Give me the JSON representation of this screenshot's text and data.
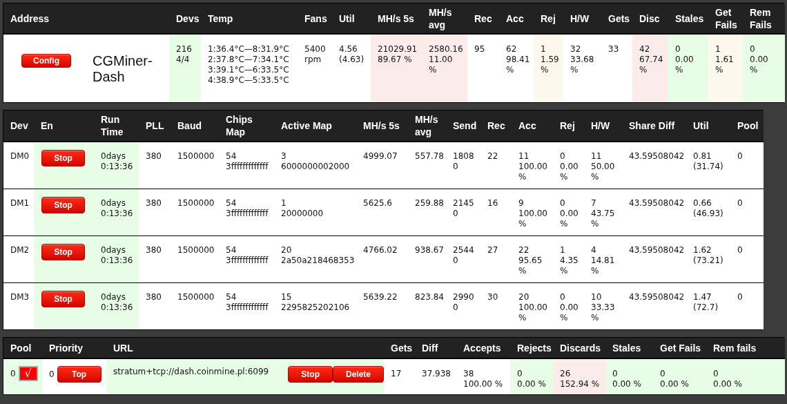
{
  "summary": {
    "columns": [
      "Address",
      "Devs",
      "Temp",
      "Fans",
      "Util",
      "MH/s 5s",
      "MH/s avg",
      "Rec",
      "Acc",
      "Rej",
      "H/W",
      "Gets",
      "Disc",
      "Stales",
      "Get Fails",
      "Rem Fails"
    ],
    "rows": [
      {
        "cells": [
          {
            "kind": "address",
            "color": "#ffffff",
            "parts": [
              {
                "kind": "button",
                "label": "Config"
              },
              {
                "kind": "name",
                "text": "CGMiner-Dash"
              }
            ]
          },
          {
            "kind": "text",
            "color": "#e8fde6",
            "lines": [
              "216",
              "4/4"
            ]
          },
          {
            "kind": "text",
            "color": "#ffffff",
            "lines": [
              "1:36.4°C—8:31.9°C",
              "2:37.8°C—7:34.1°C",
              "3:39.1°C—6:33.5°C",
              "4:38.9°C—5:33.5°C"
            ]
          },
          {
            "kind": "text",
            "color": "#ffffff",
            "lines": [
              "5400",
              "rpm"
            ]
          },
          {
            "kind": "text",
            "color": "#ffffff",
            "lines": [
              "4.56",
              "(4.63)"
            ]
          },
          {
            "kind": "text",
            "color": "#fbeceb",
            "lines": [
              "21029.91",
              "89.67 %"
            ]
          },
          {
            "kind": "text",
            "color": "#fbeceb",
            "lines": [
              "2580.16",
              "11.00",
              "%"
            ]
          },
          {
            "kind": "text",
            "color": "#ffffff",
            "lines": [
              "95"
            ]
          },
          {
            "kind": "text",
            "color": "#ffffff",
            "lines": [
              "62",
              "98.41",
              "%"
            ]
          },
          {
            "kind": "text",
            "color": "#fdf8ec",
            "lines": [
              "1",
              "1.59",
              "%"
            ]
          },
          {
            "kind": "text",
            "color": "#ffffff",
            "lines": [
              "32",
              "33.68",
              "%"
            ]
          },
          {
            "kind": "text",
            "color": "#ffffff",
            "lines": [
              "33"
            ]
          },
          {
            "kind": "text",
            "color": "#fbeceb",
            "lines": [
              "42",
              "67.74",
              "%"
            ]
          },
          {
            "kind": "text",
            "color": "#e8fde6",
            "lines": [
              "0",
              "0.00",
              "%"
            ]
          },
          {
            "kind": "text",
            "color": "#fdf8ec",
            "lines": [
              "1",
              "1.61",
              "%"
            ]
          },
          {
            "kind": "text",
            "color": "#e8fde6",
            "lines": [
              "0",
              "0.00",
              "%"
            ]
          }
        ]
      }
    ]
  },
  "devices": {
    "columns": [
      "Dev",
      "En",
      "Run Time",
      "PLL",
      "Baud",
      "Chips Map",
      "Active Map",
      "MH/s 5s",
      "MH/s avg",
      "Send",
      "Rec",
      "Acc",
      "Rej",
      "H/W",
      "Share Diff",
      "Util",
      "Pool"
    ],
    "rows": [
      {
        "cells": [
          {
            "kind": "text",
            "color": "#ffffff",
            "lines": [
              "DM0"
            ]
          },
          {
            "kind": "button",
            "color": "#e8fde6",
            "label": "Stop"
          },
          {
            "kind": "text",
            "color": "#e8fde6",
            "lines": [
              "0days",
              "0:13:36"
            ]
          },
          {
            "kind": "text",
            "color": "#ffffff",
            "lines": [
              "380"
            ]
          },
          {
            "kind": "text",
            "color": "#ffffff",
            "lines": [
              "1500000"
            ]
          },
          {
            "kind": "text",
            "color": "#ffffff",
            "lines": [
              "54",
              "3fffffffffffff"
            ]
          },
          {
            "kind": "text",
            "color": "#ffffff",
            "lines": [
              "3",
              "6000000002000"
            ]
          },
          {
            "kind": "text",
            "color": "#ffffff",
            "lines": [
              "4999.07"
            ]
          },
          {
            "kind": "text",
            "color": "#ffffff",
            "lines": [
              "557.78"
            ]
          },
          {
            "kind": "text",
            "color": "#ffffff",
            "lines": [
              "1808",
              "0"
            ]
          },
          {
            "kind": "text",
            "color": "#ffffff",
            "lines": [
              "22"
            ]
          },
          {
            "kind": "text",
            "color": "#ffffff",
            "lines": [
              "11",
              "100.00",
              "%"
            ]
          },
          {
            "kind": "text",
            "color": "#ffffff",
            "lines": [
              "0",
              "0.00",
              "%"
            ]
          },
          {
            "kind": "text",
            "color": "#ffffff",
            "lines": [
              "11",
              "50.00",
              "%"
            ]
          },
          {
            "kind": "text",
            "color": "#ffffff",
            "lines": [
              "43.59508042"
            ]
          },
          {
            "kind": "text",
            "color": "#ffffff",
            "lines": [
              "0.81",
              "(31.74)"
            ]
          },
          {
            "kind": "text",
            "color": "#ffffff",
            "lines": [
              "0"
            ]
          }
        ]
      },
      {
        "cells": [
          {
            "kind": "text",
            "color": "#ffffff",
            "lines": [
              "DM1"
            ]
          },
          {
            "kind": "button",
            "color": "#e8fde6",
            "label": "Stop"
          },
          {
            "kind": "text",
            "color": "#e8fde6",
            "lines": [
              "0days",
              "0:13:36"
            ]
          },
          {
            "kind": "text",
            "color": "#ffffff",
            "lines": [
              "380"
            ]
          },
          {
            "kind": "text",
            "color": "#ffffff",
            "lines": [
              "1500000"
            ]
          },
          {
            "kind": "text",
            "color": "#ffffff",
            "lines": [
              "54",
              "3fffffffffffff"
            ]
          },
          {
            "kind": "text",
            "color": "#ffffff",
            "lines": [
              "1",
              "20000000"
            ]
          },
          {
            "kind": "text",
            "color": "#ffffff",
            "lines": [
              "5625.6"
            ]
          },
          {
            "kind": "text",
            "color": "#ffffff",
            "lines": [
              "259.88"
            ]
          },
          {
            "kind": "text",
            "color": "#ffffff",
            "lines": [
              "2145",
              "0"
            ]
          },
          {
            "kind": "text",
            "color": "#ffffff",
            "lines": [
              "16"
            ]
          },
          {
            "kind": "text",
            "color": "#ffffff",
            "lines": [
              "9",
              "100.00",
              "%"
            ]
          },
          {
            "kind": "text",
            "color": "#ffffff",
            "lines": [
              "0",
              "0.00",
              "%"
            ]
          },
          {
            "kind": "text",
            "color": "#ffffff",
            "lines": [
              "7",
              "43.75",
              "%"
            ]
          },
          {
            "kind": "text",
            "color": "#ffffff",
            "lines": [
              "43.59508042"
            ]
          },
          {
            "kind": "text",
            "color": "#ffffff",
            "lines": [
              "0.66",
              "(46.93)"
            ]
          },
          {
            "kind": "text",
            "color": "#ffffff",
            "lines": [
              "0"
            ]
          }
        ]
      },
      {
        "cells": [
          {
            "kind": "text",
            "color": "#ffffff",
            "lines": [
              "DM2"
            ]
          },
          {
            "kind": "button",
            "color": "#e8fde6",
            "label": "Stop"
          },
          {
            "kind": "text",
            "color": "#e8fde6",
            "lines": [
              "0days",
              "0:13:36"
            ]
          },
          {
            "kind": "text",
            "color": "#ffffff",
            "lines": [
              "380"
            ]
          },
          {
            "kind": "text",
            "color": "#ffffff",
            "lines": [
              "1500000"
            ]
          },
          {
            "kind": "text",
            "color": "#ffffff",
            "lines": [
              "54",
              "3fffffffffffff"
            ]
          },
          {
            "kind": "text",
            "color": "#ffffff",
            "lines": [
              "20",
              "2a50a218468353"
            ]
          },
          {
            "kind": "text",
            "color": "#ffffff",
            "lines": [
              "4766.02"
            ]
          },
          {
            "kind": "text",
            "color": "#ffffff",
            "lines": [
              "938.67"
            ]
          },
          {
            "kind": "text",
            "color": "#ffffff",
            "lines": [
              "2544",
              "0"
            ]
          },
          {
            "kind": "text",
            "color": "#ffffff",
            "lines": [
              "27"
            ]
          },
          {
            "kind": "text",
            "color": "#ffffff",
            "lines": [
              "22",
              "95.65",
              "%"
            ]
          },
          {
            "kind": "text",
            "color": "#ffffff",
            "lines": [
              "1",
              "4.35",
              "%"
            ]
          },
          {
            "kind": "text",
            "color": "#ffffff",
            "lines": [
              "4",
              "14.81",
              "%"
            ]
          },
          {
            "kind": "text",
            "color": "#ffffff",
            "lines": [
              "43.59508042"
            ]
          },
          {
            "kind": "text",
            "color": "#ffffff",
            "lines": [
              "1.62",
              "(73.21)"
            ]
          },
          {
            "kind": "text",
            "color": "#ffffff",
            "lines": [
              "0"
            ]
          }
        ]
      },
      {
        "cells": [
          {
            "kind": "text",
            "color": "#ffffff",
            "lines": [
              "DM3"
            ]
          },
          {
            "kind": "button",
            "color": "#e8fde6",
            "label": "Stop"
          },
          {
            "kind": "text",
            "color": "#e8fde6",
            "lines": [
              "0days",
              "0:13:36"
            ]
          },
          {
            "kind": "text",
            "color": "#ffffff",
            "lines": [
              "380"
            ]
          },
          {
            "kind": "text",
            "color": "#ffffff",
            "lines": [
              "1500000"
            ]
          },
          {
            "kind": "text",
            "color": "#ffffff",
            "lines": [
              "54",
              "3fffffffffffff"
            ]
          },
          {
            "kind": "text",
            "color": "#ffffff",
            "lines": [
              "15",
              "2295825202106"
            ]
          },
          {
            "kind": "text",
            "color": "#ffffff",
            "lines": [
              "5639.22"
            ]
          },
          {
            "kind": "text",
            "color": "#ffffff",
            "lines": [
              "823.84"
            ]
          },
          {
            "kind": "text",
            "color": "#ffffff",
            "lines": [
              "2990",
              "0"
            ]
          },
          {
            "kind": "text",
            "color": "#ffffff",
            "lines": [
              "30"
            ]
          },
          {
            "kind": "text",
            "color": "#ffffff",
            "lines": [
              "20",
              "100.00",
              "%"
            ]
          },
          {
            "kind": "text",
            "color": "#ffffff",
            "lines": [
              "0",
              "0.00",
              "%"
            ]
          },
          {
            "kind": "text",
            "color": "#ffffff",
            "lines": [
              "10",
              "33.33",
              "%"
            ]
          },
          {
            "kind": "text",
            "color": "#ffffff",
            "lines": [
              "43.59508042"
            ]
          },
          {
            "kind": "text",
            "color": "#ffffff",
            "lines": [
              "1.47",
              "(72.7)"
            ]
          },
          {
            "kind": "text",
            "color": "#ffffff",
            "lines": [
              "0"
            ]
          }
        ]
      }
    ]
  },
  "pools": {
    "columns": [
      "Pool",
      "Priority",
      "URL",
      "Gets",
      "Diff",
      "Accepts",
      "Rejects",
      "Discards",
      "Stales",
      "Get Fails",
      "Rem fails"
    ],
    "rows": [
      {
        "cells": [
          {
            "kind": "controls",
            "color": "#e8fde6",
            "parts": [
              {
                "kind": "value",
                "text": "0"
              },
              {
                "kind": "checkbox",
                "checked": true,
                "label": "√"
              }
            ]
          },
          {
            "kind": "controls",
            "color": "#ffffff",
            "parts": [
              {
                "kind": "value",
                "text": "0"
              },
              {
                "kind": "button",
                "label": "Top"
              }
            ]
          },
          {
            "kind": "controls",
            "color": "#e8fde6",
            "parts": [
              {
                "kind": "value",
                "text": "stratum+tcp://dash.coinmine.pl:6099"
              },
              {
                "kind": "button",
                "label": "Stop"
              },
              {
                "kind": "button",
                "label": "Delete"
              }
            ]
          },
          {
            "kind": "text",
            "color": "#ffffff",
            "lines": [
              "17"
            ]
          },
          {
            "kind": "text",
            "color": "#ffffff",
            "lines": [
              "37.938"
            ]
          },
          {
            "kind": "text",
            "color": "#ffffff",
            "lines": [
              "38",
              "100.00 %"
            ]
          },
          {
            "kind": "text",
            "color": "#e8fde6",
            "lines": [
              "0",
              "0.00 %"
            ]
          },
          {
            "kind": "text",
            "color": "#fbeceb",
            "lines": [
              "26",
              "152.94 %"
            ]
          },
          {
            "kind": "text",
            "color": "#e8fde6",
            "lines": [
              "0",
              "0.00 %"
            ]
          },
          {
            "kind": "text",
            "color": "#e8fde6",
            "lines": [
              "0",
              "0.00 %"
            ]
          },
          {
            "kind": "text",
            "color": "#e8fde6",
            "lines": [
              "0",
              "0.00 %"
            ]
          }
        ]
      }
    ]
  }
}
